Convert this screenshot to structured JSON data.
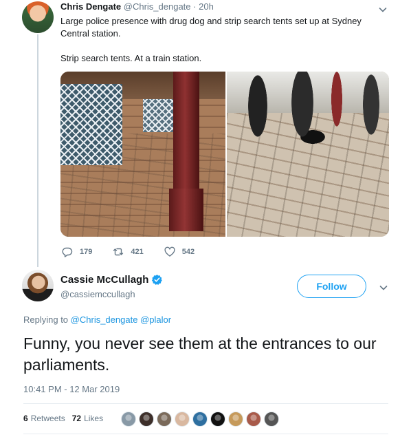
{
  "tweet1": {
    "author_name": "Chris Dengate",
    "author_handle": "@Chris_dengate",
    "separator": "·",
    "time": "20h",
    "text_line1": "Large police presence with drug dog and strip search tents set up at Sydney Central station.",
    "text_line2": "Strip search tents. At a train station.",
    "replies": "179",
    "retweets": "421",
    "likes": "542"
  },
  "tweet2": {
    "author_name": "Cassie McCullagh",
    "author_handle": "@cassiemccullagh",
    "follow_label": "Follow",
    "replying_prefix": "Replying to",
    "replying_to_1": "@Chris_dengate",
    "replying_to_2": "@plalor",
    "text": "Funny, you never see them at the entrances to our parliaments.",
    "timestamp": "10:41 PM - 12 Mar 2019",
    "retweet_count": "6",
    "retweet_label": "Retweets",
    "like_count": "72",
    "like_label": "Likes"
  },
  "colors": {
    "accent": "#1da1f2",
    "link": "#1b95e0",
    "muted": "#657786",
    "text": "#14171a",
    "divider": "#e6ecf0"
  },
  "icons": [
    "caret-down-icon",
    "reply-icon",
    "retweet-icon",
    "like-icon",
    "verified-icon"
  ],
  "liker_colors": [
    "#8899a6",
    "#3d2f2a",
    "#7a6a5a",
    "#d9b8a0",
    "#2e6fa0",
    "#111111",
    "#c69a5b",
    "#a85a4a",
    "#555555"
  ]
}
